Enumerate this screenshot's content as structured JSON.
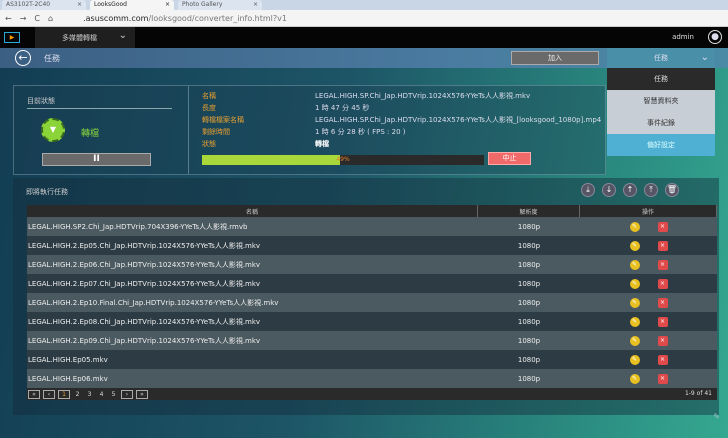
{
  "browser": {
    "tabs": [
      {
        "label": "AS3102T-2C40"
      },
      {
        "label": "LooksGood"
      },
      {
        "label": "Photo Gallery"
      }
    ],
    "url_host": ".asuscomm.com",
    "url_path": "/looksgood/converter_info.html?v1"
  },
  "topbar": {
    "menu_label": "多媒體轉檔",
    "user": "admin"
  },
  "header": {
    "title": "任務",
    "add_label": "加入",
    "dropdown_label": "任務"
  },
  "dropdown_menu": [
    {
      "label": "任務",
      "selected": true
    },
    {
      "label": "智慧資料夾"
    },
    {
      "label": "事件紀錄"
    },
    {
      "label": "偏好設定"
    }
  ],
  "status": {
    "heading": "目前狀態",
    "state": "轉檔",
    "fields": [
      {
        "key": "名稱",
        "value": "LEGAL.HIGH.SP.Chi_Jap.HDTVrip.1024X576-YYeTs人人影視.mkv"
      },
      {
        "key": "長度",
        "value": "1 時 47 分 45 秒"
      },
      {
        "key": "轉檔檔案名稱",
        "value": "LEGAL.HIGH.SP.Chi_Jap.HDTVrip.1024X576-YYeTs人人影視_[looksgood_1080p].mp4"
      },
      {
        "key": "剩餘時間",
        "value": "1 時 6 分 28 秒  ( FPS : 20 )"
      },
      {
        "key": "狀態",
        "value": "轉檔"
      }
    ],
    "progress_percent": 49,
    "progress_label": "49%",
    "stop_label": "中止"
  },
  "queue": {
    "heading": "即將執行任務",
    "columns": [
      "名稱",
      "解析度",
      "操作"
    ],
    "rows": [
      {
        "name": "LEGAL.HIGH.SP2.Chi_Jap.HDTVrip.704X396-YYeTs人人影視.rmvb",
        "res": "1080p"
      },
      {
        "name": "LEGAL.HIGH.2.Ep05.Chi_Jap.HDTVrip.1024X576-YYeTs人人影視.mkv",
        "res": "1080p"
      },
      {
        "name": "LEGAL.HIGH.2.Ep06.Chi_Jap.HDTVrip.1024X576-YYeTs人人影視.mkv",
        "res": "1080p"
      },
      {
        "name": "LEGAL.HIGH.2.Ep07.Chi_Jap.HDTVrip.1024X576-YYeTs人人影視.mkv",
        "res": "1080p"
      },
      {
        "name": "LEGAL.HIGH.2.Ep10.Final.Chi_Jap.HDTVrip.1024X576-YYeTs人人影視.mkv",
        "res": "1080p"
      },
      {
        "name": "LEGAL.HIGH.2.Ep08.Chi_Jap.HDTVrip.1024X576-YYeTs人人影視.mkv",
        "res": "1080p"
      },
      {
        "name": "LEGAL.HIGH.2.Ep09.Chi_Jap.HDTVrip.1024X576-YYeTs人人影視.mkv",
        "res": "1080p"
      },
      {
        "name": "LEGAL.HIGH.Ep05.mkv",
        "res": "1080p"
      },
      {
        "name": "LEGAL.HIGH.Ep06.mkv",
        "res": "1080p"
      }
    ],
    "pages": [
      "1",
      "2",
      "3",
      "4",
      "5"
    ],
    "current_page": "1",
    "count": "1-9 of 41"
  },
  "colors": {
    "accent_orange": "#e8a030",
    "progress": "#a8d83a",
    "stop": "#f06a6a"
  }
}
